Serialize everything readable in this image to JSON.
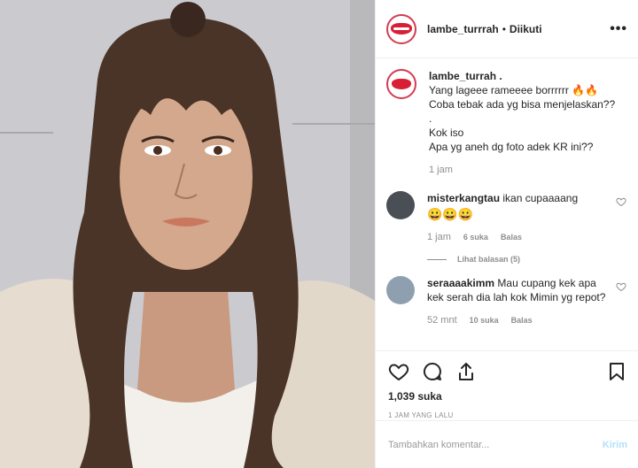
{
  "post": {
    "username": "lambe_turrrah",
    "follow_status": "Diikuti",
    "more_label": "•••"
  },
  "caption": {
    "username": "lambe_turrah .",
    "text": "Yang lageee rameeee borrrrrr 🔥🔥\nCoba tebak ada yg bisa menjelaskan??\n.\nKok iso\nApa yg aneh dg foto adek KR ini??",
    "time": "1 jam"
  },
  "comments": [
    {
      "username": "misterkangtau",
      "text": "ikan cupaaaang",
      "emoji": "😀😀😀",
      "time": "1 jam",
      "likes": "6 suka",
      "reply_label": "Balas",
      "view_replies": "Lihat balasan (5)"
    },
    {
      "username": "seraaaakimm",
      "text": "Mau cupang kek apa kek serah dia lah kok Mimin yg repot?",
      "time": "52 mnt",
      "likes": "10 suka",
      "reply_label": "Balas"
    }
  ],
  "stats": {
    "likes": "1,039 suka",
    "posted_ago": "1 JAM YANG LALU"
  },
  "add_comment": {
    "placeholder": "Tambahkan komentar...",
    "post_label": "Kirim"
  },
  "icons": {
    "like": "heart-icon",
    "comment": "comment-icon",
    "share": "share-icon",
    "save": "bookmark-icon"
  }
}
